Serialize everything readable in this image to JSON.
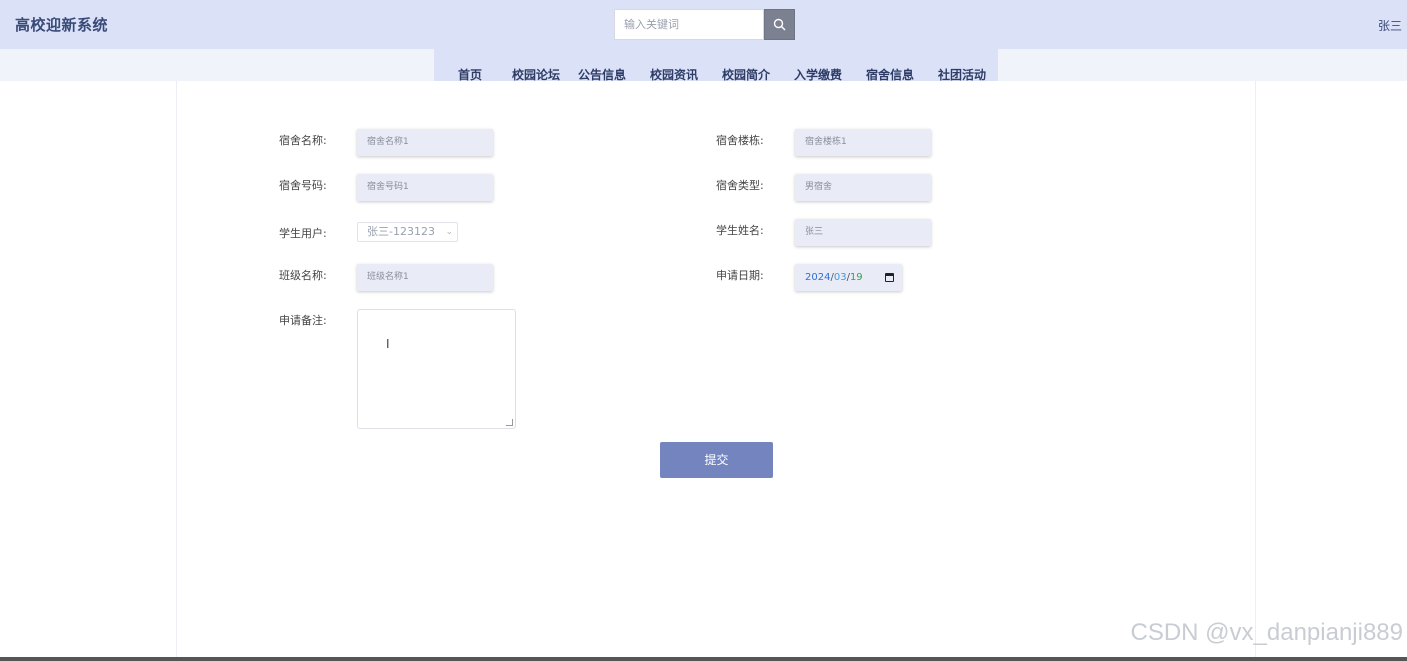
{
  "header": {
    "brand": "高校迎新系统",
    "search_placeholder": "输入关键词",
    "user": "张三"
  },
  "nav": [
    "首页",
    "校园论坛",
    "公告信息",
    "校园资讯",
    "校园简介",
    "入学缴费",
    "宿舍信息",
    "社团活动"
  ],
  "form": {
    "dorm_name": {
      "label": "宿舍名称:",
      "value": "宿舍名称1"
    },
    "dorm_building": {
      "label": "宿舍楼栋:",
      "value": "宿舍楼栋1"
    },
    "dorm_number": {
      "label": "宿舍号码:",
      "value": "宿舍号码1"
    },
    "dorm_type": {
      "label": "宿舍类型:",
      "value": "男宿舍"
    },
    "student_user": {
      "label": "学生用户:",
      "value": "张三-123123"
    },
    "student_name": {
      "label": "学生姓名:",
      "value": "张三"
    },
    "class_name": {
      "label": "班级名称:",
      "value": "班级名称1"
    },
    "apply_date": {
      "label": "申请日期:",
      "year": "2024",
      "month": "03",
      "day": "19",
      "sep": "/"
    },
    "remark": {
      "label": "申请备注:"
    },
    "submit": "提交"
  },
  "watermark": "CSDN @vx_danpianji889",
  "colors": {
    "header_bg": "#dbe2f8",
    "primary_button": "#7484bf",
    "field_bg": "#e9ebf6"
  },
  "icons": {
    "search": "search-icon",
    "calendar": "calendar-icon"
  }
}
